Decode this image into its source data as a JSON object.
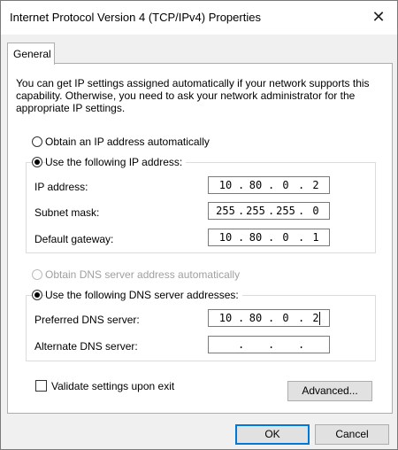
{
  "window": {
    "title": "Internet Protocol Version 4 (TCP/IPv4) Properties",
    "close_glyph": "✕"
  },
  "tabs": [
    {
      "label": "General"
    }
  ],
  "description": "You can get IP settings assigned automatically if your network supports this capability. Otherwise, you need to ask your network administrator for the appropriate IP settings.",
  "ip_section": {
    "obtain_auto_label": "Obtain an IP address automatically",
    "use_following_label": "Use the following IP address:",
    "selected": "use_following",
    "fields": [
      {
        "label": "IP address:",
        "octets": [
          "10",
          "80",
          "0",
          "2"
        ]
      },
      {
        "label": "Subnet mask:",
        "octets": [
          "255",
          "255",
          "255",
          "0"
        ]
      },
      {
        "label": "Default gateway:",
        "octets": [
          "10",
          "80",
          "0",
          "1"
        ]
      }
    ]
  },
  "dns_section": {
    "obtain_auto_label": "Obtain DNS server address automatically",
    "obtain_auto_disabled": true,
    "use_following_label": "Use the following DNS server addresses:",
    "selected": "use_following",
    "fields": [
      {
        "label": "Preferred DNS server:",
        "octets": [
          "10",
          "80",
          "0",
          "2"
        ]
      },
      {
        "label": "Alternate DNS server:",
        "octets": [
          "",
          "",
          "",
          ""
        ]
      }
    ]
  },
  "validate_label": "Validate settings upon exit",
  "validate_checked": false,
  "advanced_label": "Advanced...",
  "ok_label": "OK",
  "cancel_label": "Cancel",
  "colors": {
    "focus_border": "#0078d7",
    "disabled_text": "#a0a0a0"
  }
}
